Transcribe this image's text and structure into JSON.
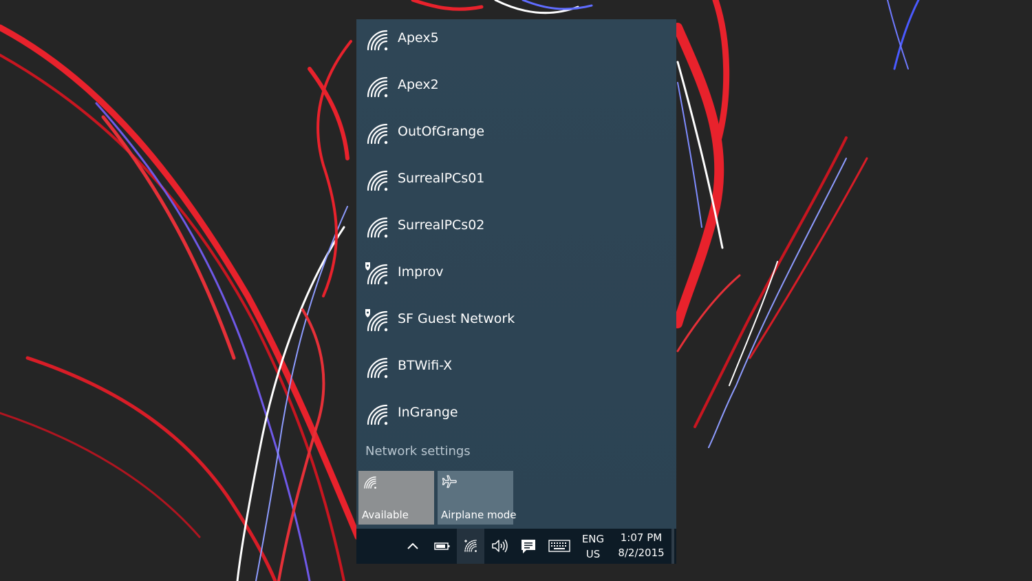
{
  "networks": [
    {
      "name": "Apex5",
      "secured": false
    },
    {
      "name": "Apex2",
      "secured": false
    },
    {
      "name": "OutOfGrange",
      "secured": false
    },
    {
      "name": "SurrealPCs01",
      "secured": false
    },
    {
      "name": "SurrealPCs02",
      "secured": false
    },
    {
      "name": "Improv",
      "secured": true
    },
    {
      "name": "SF Guest Network",
      "secured": true
    },
    {
      "name": "BTWifi-X",
      "secured": false
    },
    {
      "name": "InGrange",
      "secured": false
    }
  ],
  "settings_link": "Network settings",
  "quick_actions": {
    "wifi": {
      "label": "Available",
      "icon": "wifi-icon"
    },
    "airplane": {
      "label": "Airplane mode",
      "icon": "airplane-icon"
    }
  },
  "taskbar": {
    "language_line1": "ENG",
    "language_line2": "US",
    "time": "1:07 PM",
    "date": "8/2/2015",
    "icons": [
      "chevron-up-icon",
      "battery-icon",
      "wifi-icon",
      "volume-icon",
      "action-center-icon",
      "keyboard-icon"
    ]
  },
  "colors": {
    "flyout_bg": "#2e4555",
    "tile_wifi": "#8d9092",
    "tile_airplane": "#5c7280",
    "taskbar_bg": "#0d1b26",
    "text": "#ffffff",
    "link": "#b8c6d0"
  }
}
